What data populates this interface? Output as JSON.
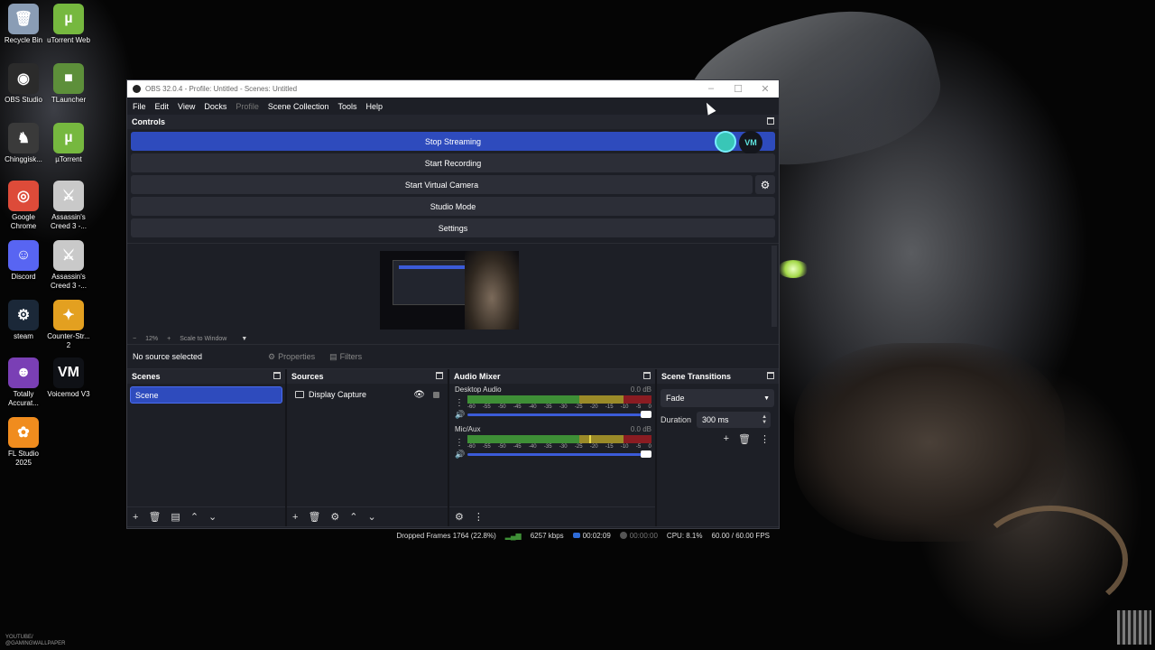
{
  "desktop": {
    "icons": [
      {
        "label": "Recycle Bin",
        "icon": "recycle-bin-icon",
        "color": "#8a9db5",
        "glyph": "🗑"
      },
      {
        "label": "uTorrent Web",
        "icon": "utorrent-icon",
        "color": "#76b83f",
        "glyph": "µ"
      },
      {
        "label": "OBS Studio",
        "icon": "obs-icon",
        "color": "#2b2b2b",
        "glyph": "◉"
      },
      {
        "label": "TLauncher",
        "icon": "tlauncher-icon",
        "color": "#5d8f3a",
        "glyph": "■"
      },
      {
        "label": "Chinggisk...",
        "icon": "game-icon",
        "color": "#3a3a3a",
        "glyph": "♞"
      },
      {
        "label": "µTorrent",
        "icon": "utorrent-icon",
        "color": "#76b83f",
        "glyph": "µ"
      },
      {
        "label": "Google Chrome",
        "icon": "chrome-icon",
        "color": "#dd4b39",
        "glyph": "◎"
      },
      {
        "label": "Assassin's Creed 3 -...",
        "icon": "assassins-creed-icon",
        "color": "#c9c9c9",
        "glyph": "⚔"
      },
      {
        "label": "Discord",
        "icon": "discord-icon",
        "color": "#5865f2",
        "glyph": "☺"
      },
      {
        "label": "Assassin's Creed 3 -...",
        "icon": "assassins-creed-icon",
        "color": "#c9c9c9",
        "glyph": "⚔"
      },
      {
        "label": "steam",
        "icon": "steam-icon",
        "color": "#1b2838",
        "glyph": "⚙"
      },
      {
        "label": "Counter-Str... 2",
        "icon": "counter-strike-icon",
        "color": "#e3a020",
        "glyph": "✦"
      },
      {
        "label": "Totally Accurat...",
        "icon": "tabs-icon",
        "color": "#7a3fb5",
        "glyph": "☻"
      },
      {
        "label": "Voicemod V3",
        "icon": "voicemod-icon",
        "color": "#0f1116",
        "glyph": "VM"
      },
      {
        "label": "FL Studio 2025",
        "icon": "fl-studio-icon",
        "color": "#f08c1e",
        "glyph": "✿"
      }
    ],
    "watermark": "YOUTUBE/\n@GAMINGWALLPAPER"
  },
  "window": {
    "title": "OBS 32.0.4 - Profile: Untitled - Scenes: Untitled",
    "controls": [
      "–",
      "☐",
      "✕"
    ]
  },
  "menu": [
    "File",
    "Edit",
    "View",
    "Docks",
    "Profile",
    "Scene Collection",
    "Tools",
    "Help"
  ],
  "controls": {
    "title": "Controls",
    "stop_streaming": "Stop Streaming",
    "start_recording": "Start Recording",
    "start_virtual_camera": "Start Virtual Camera",
    "studio_mode": "Studio Mode",
    "settings": "Settings",
    "overlay_logo": "VM"
  },
  "preview": {
    "zoom_minus": "−",
    "zoom_level": "12%",
    "zoom_plus": "+",
    "scale_mode": "Scale to Window",
    "dropdown": "▼"
  },
  "context": {
    "no_source": "No source selected",
    "properties": "Properties",
    "filters": "Filters"
  },
  "scenes": {
    "title": "Scenes",
    "items": [
      "Scene"
    ]
  },
  "sources": {
    "title": "Sources",
    "items": [
      "Display Capture"
    ]
  },
  "mixer": {
    "title": "Audio Mixer",
    "channels": [
      {
        "name": "Desktop Audio",
        "db": "0.0 dB",
        "level": 1.0
      },
      {
        "name": "Mic/Aux",
        "db": "0.0 dB",
        "level": 1.0
      }
    ],
    "ticks": [
      "-60",
      "-55",
      "-50",
      "-45",
      "-40",
      "-35",
      "-30",
      "-25",
      "-20",
      "-15",
      "-10",
      "-5",
      "0"
    ]
  },
  "transitions": {
    "title": "Scene Transitions",
    "selected": "Fade",
    "duration_label": "Duration",
    "duration_value": "300 ms"
  },
  "status": {
    "dropped_frames": "Dropped Frames 1764 (22.8%)",
    "bitrate": "6257 kbps",
    "stream_time": "00:02:09",
    "record_time": "00:00:00",
    "cpu": "CPU: 8.1%",
    "fps": "60.00 / 60.00 FPS"
  },
  "colors": {
    "accent": "#2e4bbd",
    "panel": "#1d1f26",
    "button": "#2c2e37"
  }
}
